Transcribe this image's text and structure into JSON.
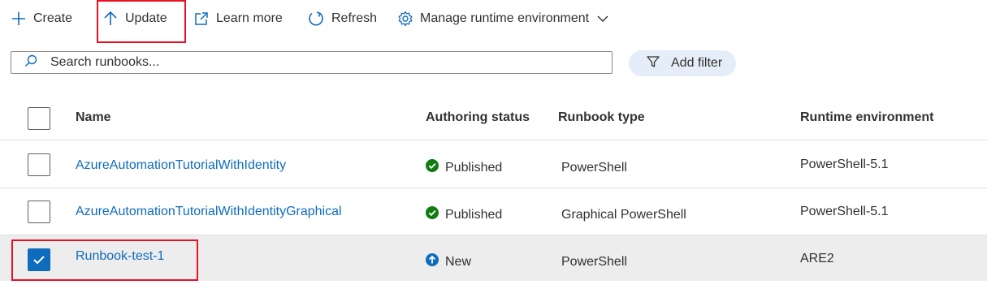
{
  "toolbar": {
    "create_label": "Create",
    "update_label": "Update",
    "learn_more_label": "Learn more",
    "refresh_label": "Refresh",
    "manage_runtime_label": "Manage runtime environment"
  },
  "search": {
    "placeholder": "Search runbooks..."
  },
  "filter": {
    "label": "Add filter"
  },
  "table": {
    "columns": {
      "name": "Name",
      "authoring_status": "Authoring status",
      "runbook_type": "Runbook type",
      "runtime_environment": "Runtime environment"
    },
    "rows": [
      {
        "name": "AzureAutomationTutorialWithIdentity",
        "status": "Published",
        "status_icon": "published-check-icon",
        "type": "PowerShell",
        "runtime": "PowerShell-5.1",
        "selected": false
      },
      {
        "name": "AzureAutomationTutorialWithIdentityGraphical",
        "status": "Published",
        "status_icon": "published-check-icon",
        "type": "Graphical PowerShell",
        "runtime": "PowerShell-5.1",
        "selected": false
      },
      {
        "name": "Runbook-test-1",
        "status": "New",
        "status_icon": "new-arrow-up-icon",
        "type": "PowerShell",
        "runtime": "ARE2",
        "selected": true
      }
    ]
  },
  "colors": {
    "accent": "#0f6cbd",
    "published_green": "#107c10",
    "highlight_red": "#e81123",
    "selected_row_bg": "#ededed",
    "filter_pill_bg": "#e5eef8"
  }
}
